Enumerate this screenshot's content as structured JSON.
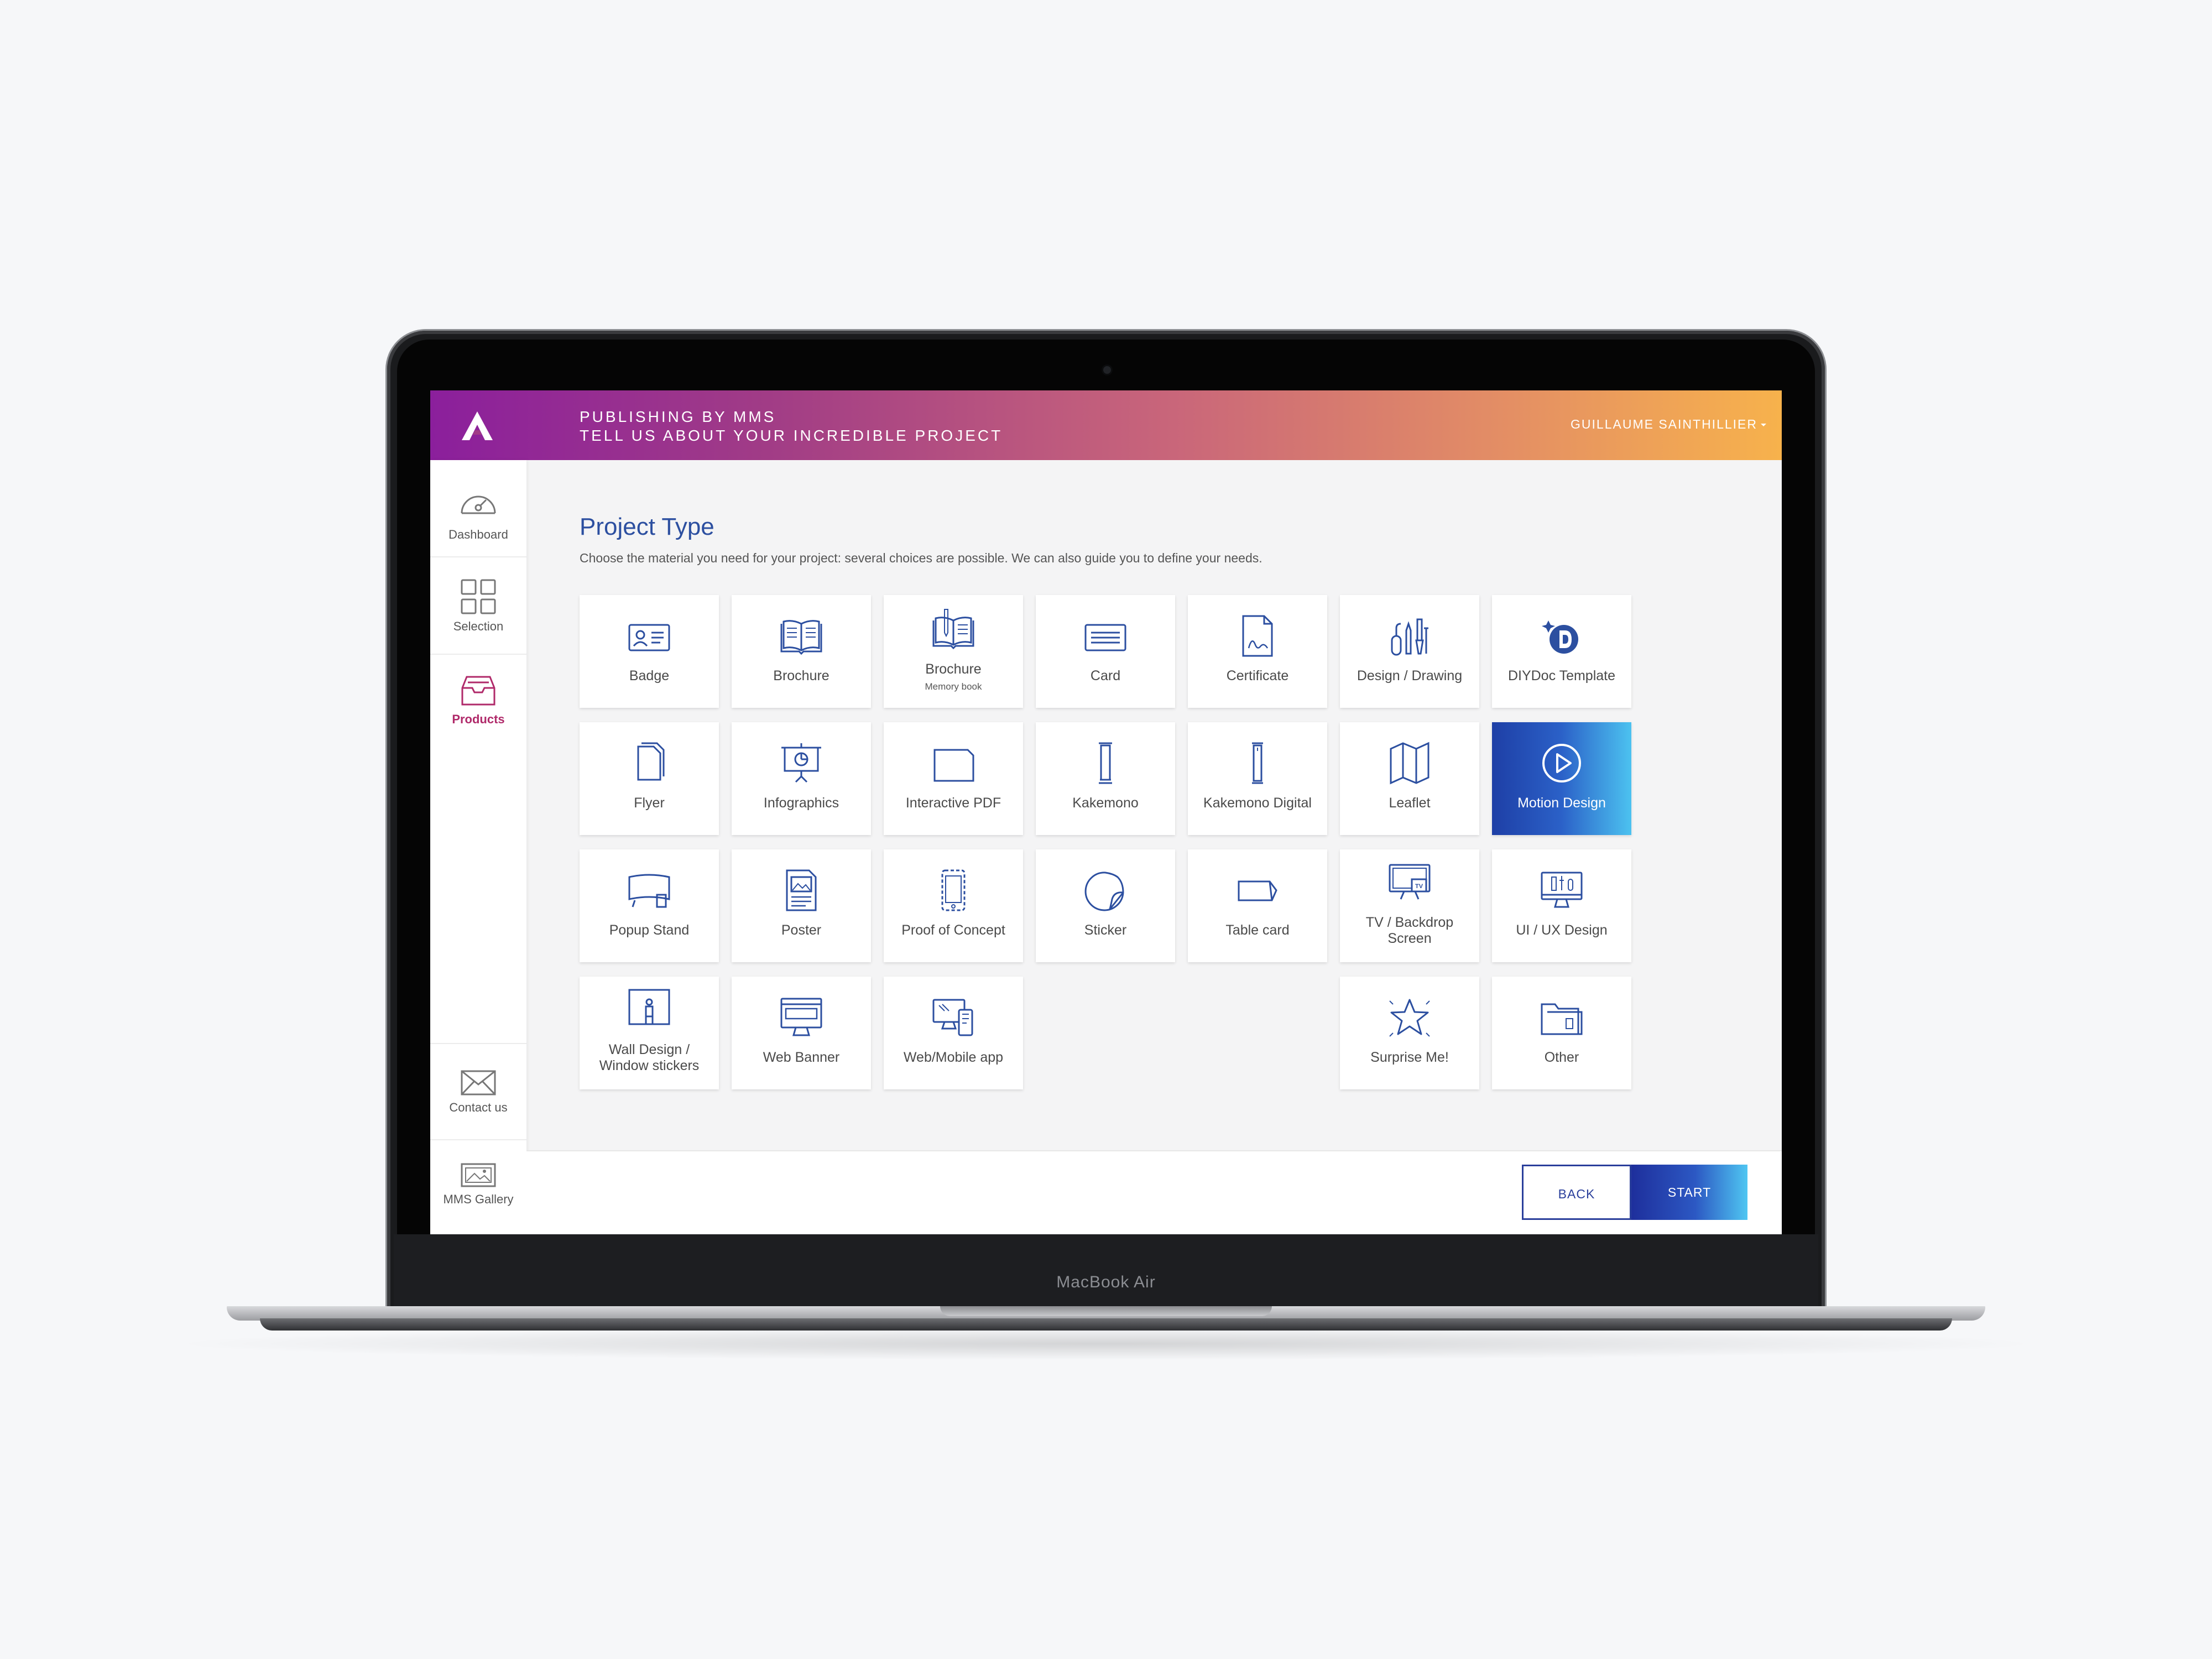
{
  "device": {
    "model_label": "MacBook Air"
  },
  "header": {
    "line1": "PUBLISHING BY MMS",
    "line2": "TELL US ABOUT YOUR INCREDIBLE PROJECT",
    "user": "GUILLAUME SAINTHILLIER"
  },
  "sidebar": {
    "items": [
      {
        "label": "Dashboard",
        "icon": "gauge-icon"
      },
      {
        "label": "Selection",
        "icon": "grid-icon"
      },
      {
        "label": "Products",
        "icon": "inbox-tray-icon",
        "active": true
      },
      {
        "label": "Contact us",
        "icon": "envelope-icon"
      },
      {
        "label": "MMS Gallery",
        "icon": "gallery-icon"
      }
    ]
  },
  "main": {
    "title": "Project Type",
    "subtitle": "Choose the material you need for your project: several choices are possible. We can also guide you to define your needs."
  },
  "tiles": [
    {
      "label": "Badge",
      "icon": "badge-icon"
    },
    {
      "label": "Brochure",
      "icon": "book-icon"
    },
    {
      "label": "Brochure",
      "sublabel": "Memory book",
      "icon": "memory-book-icon"
    },
    {
      "label": "Card",
      "icon": "card-icon"
    },
    {
      "label": "Certificate",
      "icon": "certificate-icon"
    },
    {
      "label": "Design / Drawing",
      "icon": "drawing-tools-icon"
    },
    {
      "label": "DIYDoc Template",
      "icon": "diydoc-logo-icon"
    },
    {
      "label": "Flyer",
      "icon": "flyer-icon"
    },
    {
      "label": "Infographics",
      "icon": "presentation-board-icon"
    },
    {
      "label": "Interactive PDF",
      "icon": "document-icon"
    },
    {
      "label": "Kakemono",
      "icon": "rollup-banner-icon"
    },
    {
      "label": "Kakemono Digital",
      "icon": "digital-rollup-icon"
    },
    {
      "label": "Leaflet",
      "icon": "folded-map-icon"
    },
    {
      "label": "Motion Design",
      "icon": "play-circle-icon",
      "selected": true
    },
    {
      "label": "Popup Stand",
      "icon": "popup-stand-icon"
    },
    {
      "label": "Poster",
      "icon": "poster-icon"
    },
    {
      "label": "Proof of Concept",
      "icon": "phone-sketch-icon"
    },
    {
      "label": "Sticker",
      "icon": "sticker-icon"
    },
    {
      "label": "Table card",
      "icon": "table-card-icon"
    },
    {
      "label": "TV / Backdrop Screen",
      "icon": "tv-screen-icon"
    },
    {
      "label": "UI / UX Design",
      "icon": "monitor-design-icon"
    },
    {
      "label": "Wall Design / Window stickers",
      "icon": "wall-design-icon"
    },
    {
      "label": "Web Banner",
      "icon": "web-banner-icon"
    },
    {
      "label": "Web/Mobile app",
      "icon": "devices-icon"
    },
    {
      "label": "Surprise Me!",
      "icon": "star-icon"
    },
    {
      "label": "Other",
      "icon": "folder-icon"
    }
  ],
  "footer": {
    "back_label": "BACK",
    "start_label": "START"
  },
  "colors": {
    "accent_blue": "#2c4fa0",
    "brand_magenta": "#8b1f9c",
    "brand_orange": "#f7b24c",
    "active_nav": "#b02a6a"
  }
}
